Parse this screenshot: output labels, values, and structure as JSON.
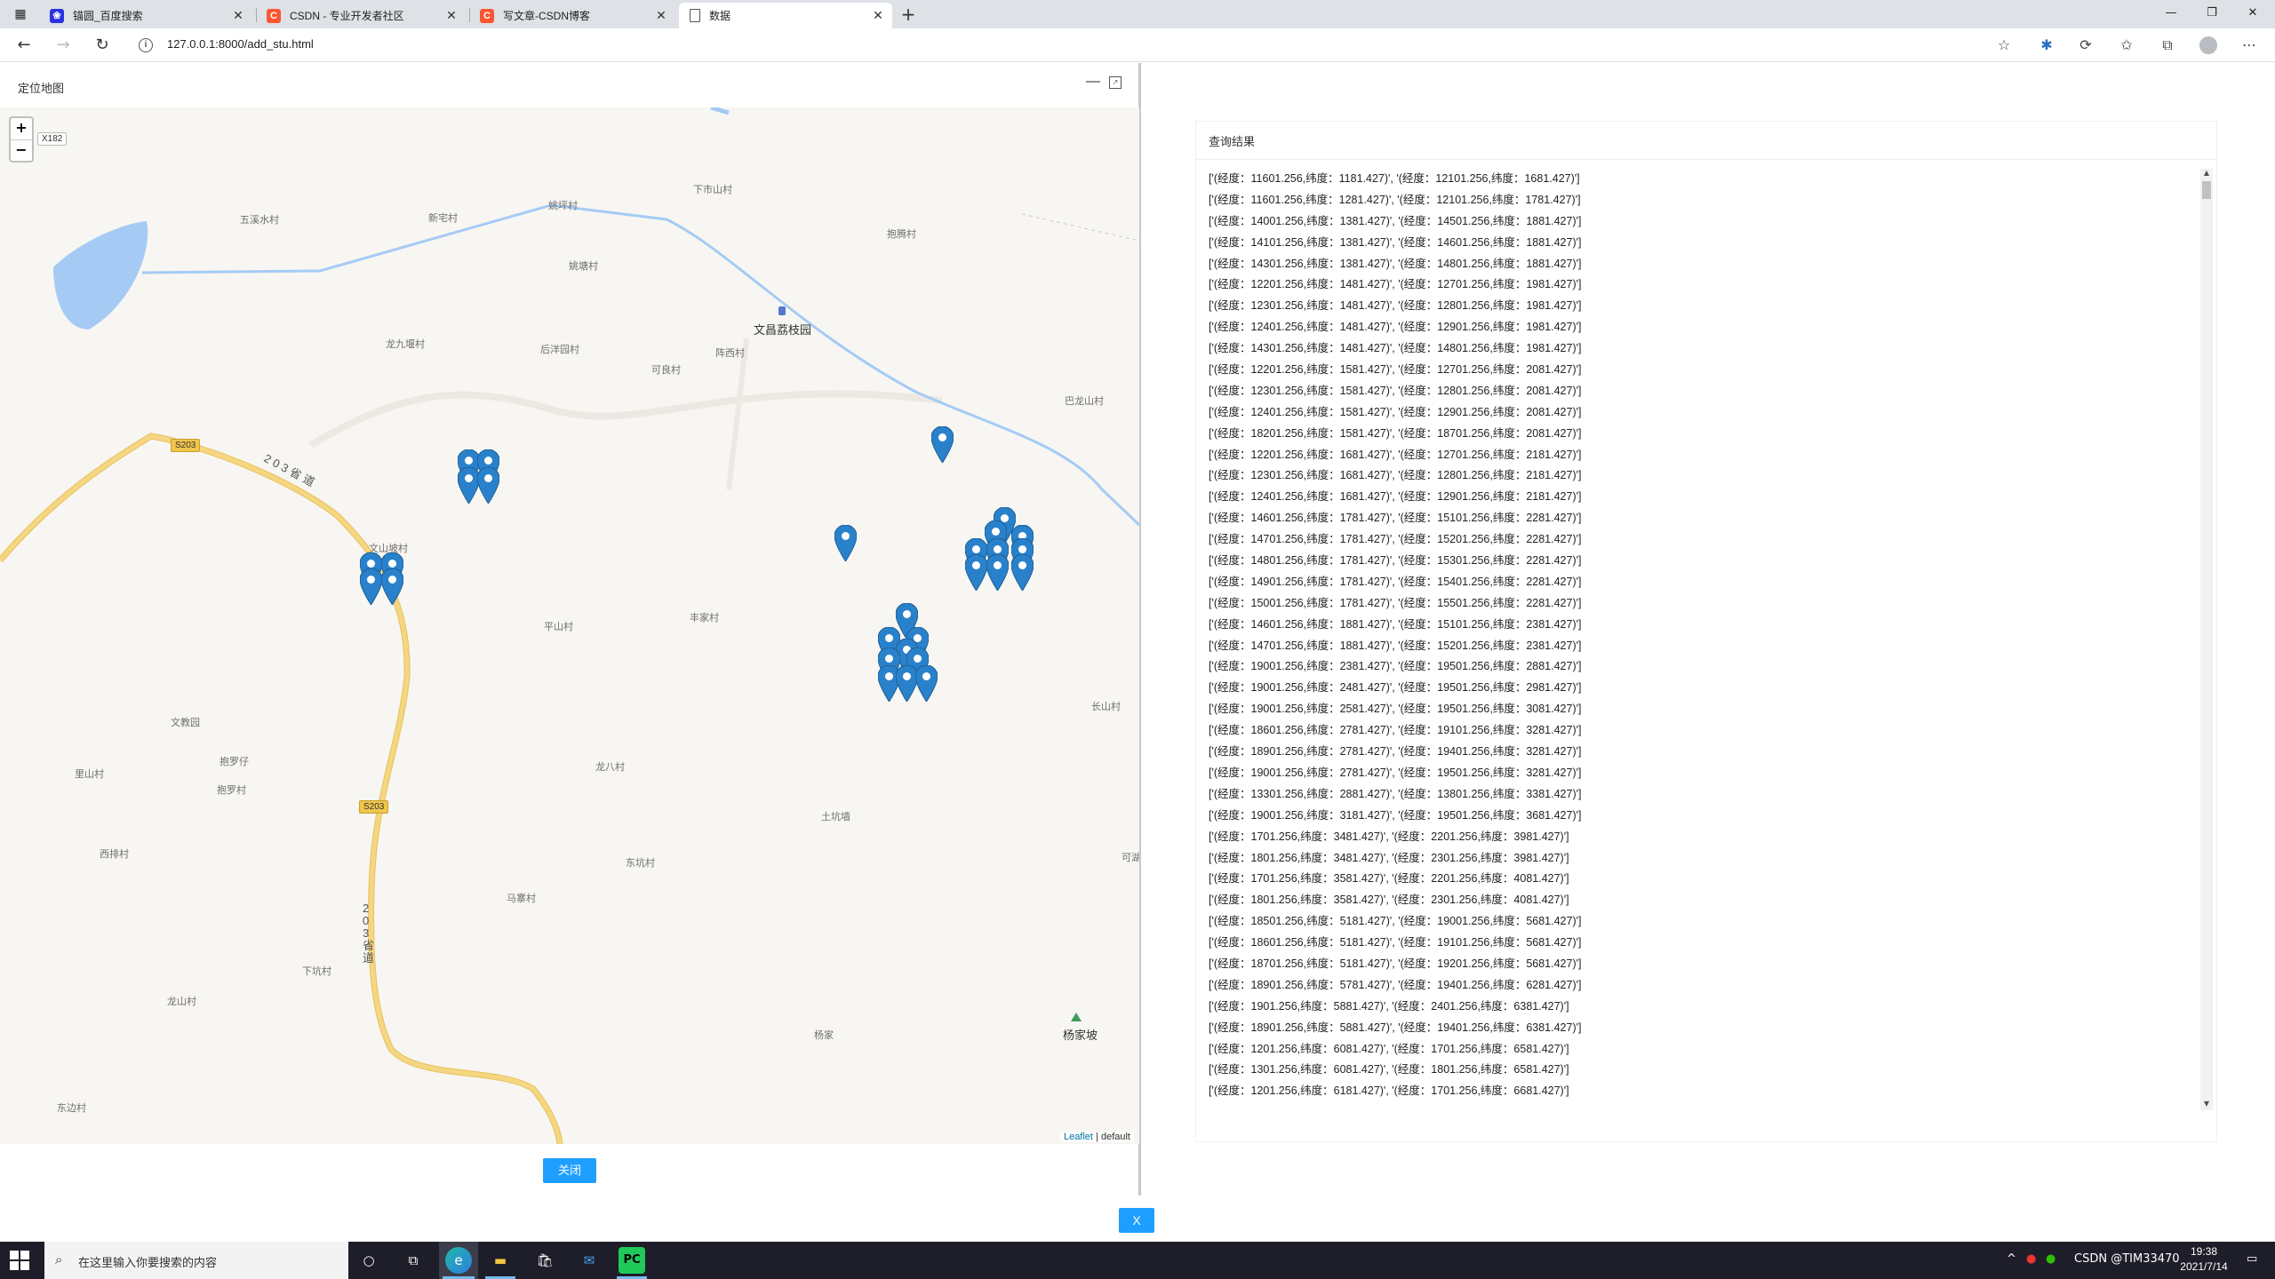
{
  "browser": {
    "tabs": [
      {
        "title": "锚圆_百度搜索",
        "icon": "baidu-icon",
        "active": false
      },
      {
        "title": "CSDN - 专业开发者社区",
        "icon": "csdn-icon",
        "active": false
      },
      {
        "title": "写文章-CSDN博客",
        "icon": "csdn-icon",
        "active": false
      },
      {
        "title": "数据",
        "icon": "page-icon",
        "active": true
      }
    ],
    "url": "127.0.0.1:8000/add_stu.html"
  },
  "map_dialog": {
    "title": "定位地图",
    "close_button": "关闭",
    "zoom_in": "+",
    "zoom_out": "−",
    "attribution_link": "Leaflet",
    "attribution_text": "| default",
    "roads": {
      "s203_a": "S203",
      "s203_b": "S203",
      "x182": "X182",
      "prov_a": "2 0 3 省 道",
      "prov_b": "2 0 3 省 道"
    },
    "places": [
      "五溪水村",
      "新宅村",
      "姚坪村",
      "下市山村",
      "姚塘村",
      "抱腾村",
      "文昌荔枝园",
      "龙九堰村",
      "后洋园村",
      "阵西村",
      "可良村",
      "巴龙山村",
      "文山坡村",
      "平山村",
      "丰家村",
      "长山村",
      "文教园",
      "抱罗仔",
      "里山村",
      "抱罗村",
      "龙八村",
      "土坑墙",
      "西排村",
      "东坑村",
      "马寨村",
      "下坑村",
      "龙山村",
      "杨家",
      "杨家坡",
      "东边村",
      "可湖"
    ]
  },
  "results": {
    "title": "查询结果",
    "close_x": "X",
    "lines": [
      "['(经度：11601.256,纬度：1181.427)', '(经度：12101.256,纬度：1681.427)']",
      "['(经度：11601.256,纬度：1281.427)', '(经度：12101.256,纬度：1781.427)']",
      "['(经度：14001.256,纬度：1381.427)', '(经度：14501.256,纬度：1881.427)']",
      "['(经度：14101.256,纬度：1381.427)', '(经度：14601.256,纬度：1881.427)']",
      "['(经度：14301.256,纬度：1381.427)', '(经度：14801.256,纬度：1881.427)']",
      "['(经度：12201.256,纬度：1481.427)', '(经度：12701.256,纬度：1981.427)']",
      "['(经度：12301.256,纬度：1481.427)', '(经度：12801.256,纬度：1981.427)']",
      "['(经度：12401.256,纬度：1481.427)', '(经度：12901.256,纬度：1981.427)']",
      "['(经度：14301.256,纬度：1481.427)', '(经度：14801.256,纬度：1981.427)']",
      "['(经度：12201.256,纬度：1581.427)', '(经度：12701.256,纬度：2081.427)']",
      "['(经度：12301.256,纬度：1581.427)', '(经度：12801.256,纬度：2081.427)']",
      "['(经度：12401.256,纬度：1581.427)', '(经度：12901.256,纬度：2081.427)']",
      "['(经度：18201.256,纬度：1581.427)', '(经度：18701.256,纬度：2081.427)']",
      "['(经度：12201.256,纬度：1681.427)', '(经度：12701.256,纬度：2181.427)']",
      "['(经度：12301.256,纬度：1681.427)', '(经度：12801.256,纬度：2181.427)']",
      "['(经度：12401.256,纬度：1681.427)', '(经度：12901.256,纬度：2181.427)']",
      "['(经度：14601.256,纬度：1781.427)', '(经度：15101.256,纬度：2281.427)']",
      "['(经度：14701.256,纬度：1781.427)', '(经度：15201.256,纬度：2281.427)']",
      "['(经度：14801.256,纬度：1781.427)', '(经度：15301.256,纬度：2281.427)']",
      "['(经度：14901.256,纬度：1781.427)', '(经度：15401.256,纬度：2281.427)']",
      "['(经度：15001.256,纬度：1781.427)', '(经度：15501.256,纬度：2281.427)']",
      "['(经度：14601.256,纬度：1881.427)', '(经度：15101.256,纬度：2381.427)']",
      "['(经度：14701.256,纬度：1881.427)', '(经度：15201.256,纬度：2381.427)']",
      "['(经度：19001.256,纬度：2381.427)', '(经度：19501.256,纬度：2881.427)']",
      "['(经度：19001.256,纬度：2481.427)', '(经度：19501.256,纬度：2981.427)']",
      "['(经度：19001.256,纬度：2581.427)', '(经度：19501.256,纬度：3081.427)']",
      "['(经度：18601.256,纬度：2781.427)', '(经度：19101.256,纬度：3281.427)']",
      "['(经度：18901.256,纬度：2781.427)', '(经度：19401.256,纬度：3281.427)']",
      "['(经度：19001.256,纬度：2781.427)', '(经度：19501.256,纬度：3281.427)']",
      "['(经度：13301.256,纬度：2881.427)', '(经度：13801.256,纬度：3381.427)']",
      "['(经度：19001.256,纬度：3181.427)', '(经度：19501.256,纬度：3681.427)']",
      "['(经度：1701.256,纬度：3481.427)', '(经度：2201.256,纬度：3981.427)']",
      "['(经度：1801.256,纬度：3481.427)', '(经度：2301.256,纬度：3981.427)']",
      "['(经度：1701.256,纬度：3581.427)', '(经度：2201.256,纬度：4081.427)']",
      "['(经度：1801.256,纬度：3581.427)', '(经度：2301.256,纬度：4081.427)']",
      "['(经度：18501.256,纬度：5181.427)', '(经度：19001.256,纬度：5681.427)']",
      "['(经度：18601.256,纬度：5181.427)', '(经度：19101.256,纬度：5681.427)']",
      "['(经度：18701.256,纬度：5181.427)', '(经度：19201.256,纬度：5681.427)']",
      "['(经度：18901.256,纬度：5781.427)', '(经度：19401.256,纬度：6281.427)']",
      "['(经度：1901.256,纬度：5881.427)', '(经度：2401.256,纬度：6381.427)']",
      "['(经度：18901.256,纬度：5881.427)', '(经度：19401.256,纬度：6381.427)']",
      "['(经度：1201.256,纬度：6081.427)', '(经度：1701.256,纬度：6581.427)']",
      "['(经度：1301.256,纬度：6081.427)', '(经度：1801.256,纬度：6581.427)']",
      "['(经度：1201.256,纬度：6181.427)', '(经度：1701.256,纬度：6681.427)']"
    ]
  },
  "taskbar": {
    "search_placeholder": "在这里输入你要搜索的内容",
    "tray_text": "CSDN @TIM33470",
    "time": "19:38",
    "date": "2021/7/14"
  },
  "colors": {
    "accent": "#1e9fff",
    "marker": "#2a81cb",
    "water": "#a5cbf5",
    "road": "#f5d682"
  }
}
